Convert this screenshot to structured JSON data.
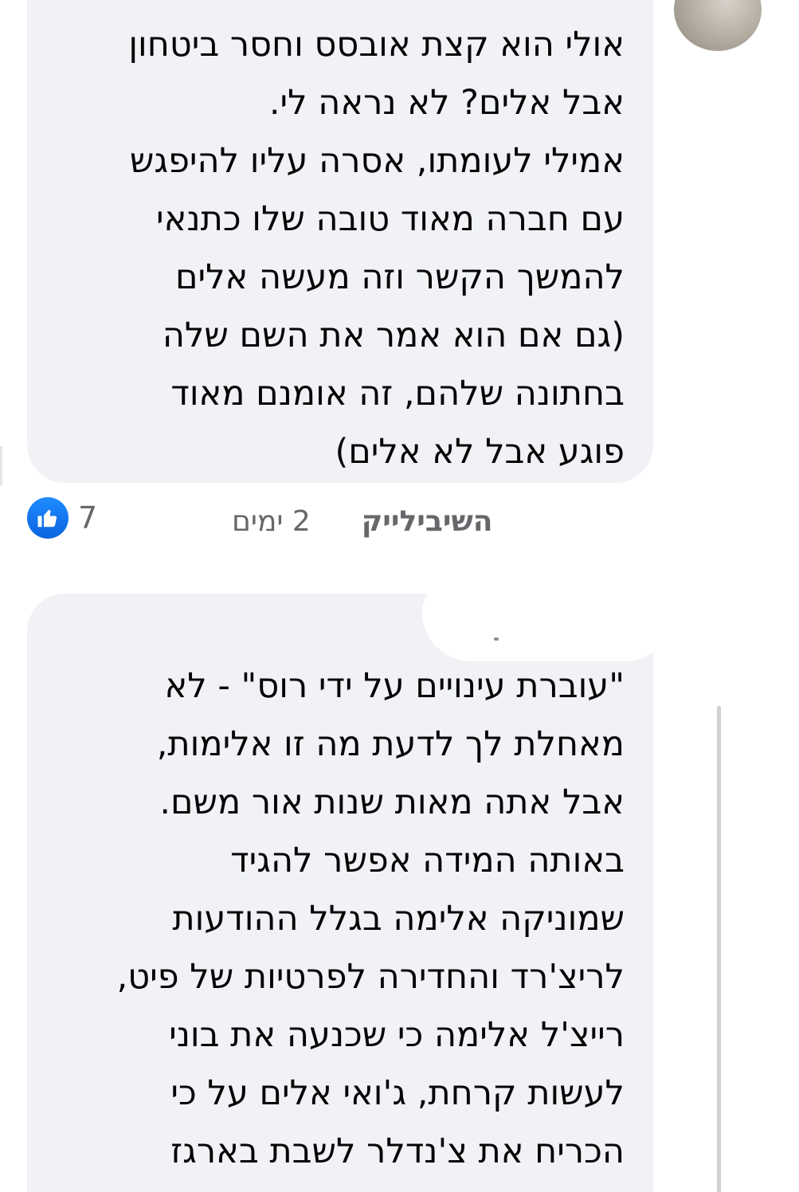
{
  "comment_1": {
    "text": "אולי הוא קצת אובסס וחסר ביטחון\nאבל אלים? לא נראה לי.\nאמילי לעומתו, אסרה עליו להיפגש\nעם חברה מאוד טובה שלו כתנאי\nלהמשך הקשר וזה מעשה אלים\n(גם אם הוא אמר את השם שלה\nבחתונה שלהם, זה אומנם מאוד\nפוגע אבל לא אלים)",
    "time": "2 ימים",
    "like_label": "לייק",
    "reply_label": "השיבי",
    "reaction_count": "7",
    "reaction_icon": "thumbs-up-icon"
  },
  "comment_2": {
    "text": "\"עוברת עינויים על ידי רוס\" - לא\nמאחלת לך לדעת מה זו אלימות,\nאבל אתה מאות שנות אור משם.\nבאותה המידה אפשר להגיד\nשמוניקה אלימה בגלל ההודעות\nלריצ'רד והחדירה לפרטיות של פיט,\nרייצ'ל אלימה כי שכנעה את בוני\nלעשות קרחת, ג'ואי אלים על כי\nהכריח את צ'נדלר לשבת בארגז"
  },
  "colors": {
    "bubble": "#f0f2f5",
    "text": "#050505",
    "meta": "#65676b",
    "like_blue": "#1877f2"
  }
}
